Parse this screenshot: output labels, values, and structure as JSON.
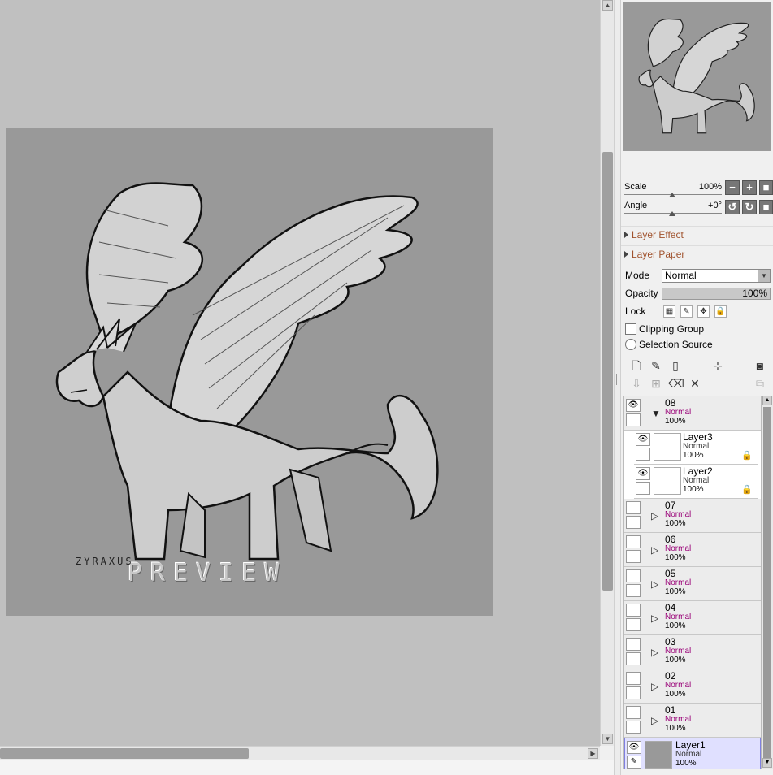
{
  "canvas": {
    "watermark": "PREVIEW",
    "signature": "ZYRAXUS"
  },
  "navigator": {
    "scale_label": "Scale",
    "scale_value": "100%",
    "angle_label": "Angle",
    "angle_value": "+0°"
  },
  "sections": {
    "layer_effect": "Layer Effect",
    "layer_paper": "Layer Paper"
  },
  "properties": {
    "mode_label": "Mode",
    "mode_value": "Normal",
    "opacity_label": "Opacity",
    "opacity_value": "100%",
    "lock_label": "Lock",
    "clipping_group": "Clipping Group",
    "selection_source": "Selection Source"
  },
  "layers": [
    {
      "name": "08",
      "mode": "Normal",
      "opacity": "100%",
      "type": "folder",
      "expanded": true
    },
    {
      "name": "Layer3",
      "mode": "Normal",
      "opacity": "100%",
      "type": "child"
    },
    {
      "name": "Layer2",
      "mode": "Normal",
      "opacity": "100%",
      "type": "child"
    },
    {
      "name": "07",
      "mode": "Normal",
      "opacity": "100%",
      "type": "folder"
    },
    {
      "name": "06",
      "mode": "Normal",
      "opacity": "100%",
      "type": "folder"
    },
    {
      "name": "05",
      "mode": "Normal",
      "opacity": "100%",
      "type": "folder"
    },
    {
      "name": "04",
      "mode": "Normal",
      "opacity": "100%",
      "type": "folder"
    },
    {
      "name": "03",
      "mode": "Normal",
      "opacity": "100%",
      "type": "folder"
    },
    {
      "name": "02",
      "mode": "Normal",
      "opacity": "100%",
      "type": "folder"
    },
    {
      "name": "01",
      "mode": "Normal",
      "opacity": "100%",
      "type": "folder"
    },
    {
      "name": "Layer1",
      "mode": "Normal",
      "opacity": "100%",
      "type": "selected"
    }
  ],
  "colors": {
    "folder_mode_text": "#990077",
    "section_header": "#a0522d",
    "selected_layer_bg": "#e0e0ff"
  }
}
